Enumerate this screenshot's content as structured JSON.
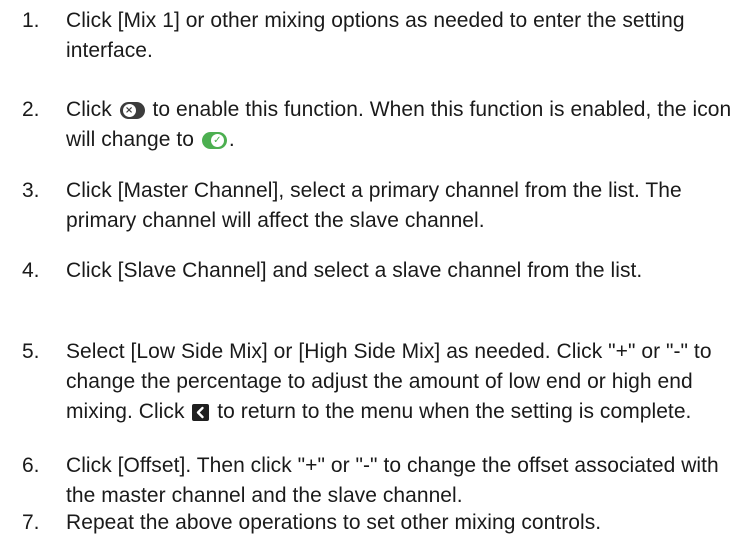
{
  "steps": [
    {
      "number": "1.",
      "text": "Click [Mix 1] or other mixing options as needed to enter the setting interface."
    },
    {
      "number": "2.",
      "text_a": "Click",
      "text_b": "to enable this function. When this function is enabled, the icon will change to",
      "text_c": ".",
      "icon_off": "toggle-off-icon",
      "icon_on": "toggle-on-icon"
    },
    {
      "number": "3.",
      "text": "Click [Master Channel], select a primary channel from the list. The primary channel will affect the slave channel."
    },
    {
      "number": "4.",
      "text": "Click [Slave Channel] and select a slave channel from the list."
    },
    {
      "number": "5.",
      "text_a": "Select [Low Side Mix] or [High Side Mix] as needed. Click \"+\" or \"-\" to change the percentage to adjust the amount of low end or high end mixing. Click",
      "text_b": "to return to the menu when the setting is complete.",
      "icon_back": "back-arrow-icon"
    },
    {
      "number": "6.",
      "text": "Click [Offset]. Then click \"+\" or \"-\" to change the offset associated with the master channel and the slave channel."
    },
    {
      "number": "7.",
      "text": "Repeat the above operations to set other mixing controls."
    }
  ],
  "colors": {
    "text": "#1a1a1a",
    "toggle_off": "#3c3c3c",
    "toggle_on": "#4caf50",
    "back_icon": "#1f1f1f"
  }
}
